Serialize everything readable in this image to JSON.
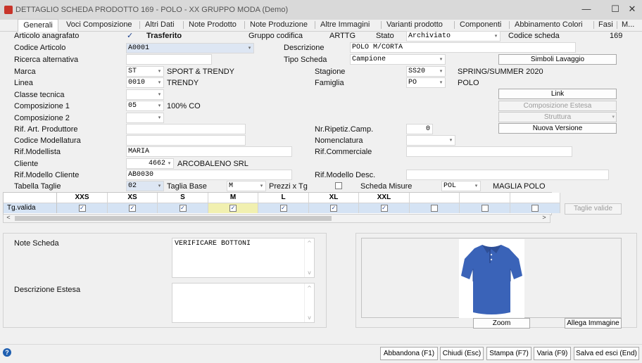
{
  "window": {
    "title": "DETTAGLIO SCHEDA PRODOTTO 169 - POLO - XX  GRUPPO MODA  (Demo)",
    "minimize_glyph": "—",
    "maximize_glyph": "☐",
    "close_glyph": "✕"
  },
  "tabs": [
    {
      "label": "Generali",
      "active": true
    },
    {
      "label": "Voci Composizione"
    },
    {
      "label": "Altri Dati"
    },
    {
      "label": "Note Prodotto"
    },
    {
      "label": "Note Produzione"
    },
    {
      "label": "Altre Immagini"
    },
    {
      "label": "Varianti prodotto"
    },
    {
      "label": "Componenti"
    },
    {
      "label": "Abbinamento Colori"
    },
    {
      "label": "Fasi"
    },
    {
      "label": "M..."
    }
  ],
  "form": {
    "articolo_anagrafato": {
      "label": "Articolo anagrafato",
      "checked": true,
      "check_glyph": "✓"
    },
    "trasferito": "Trasferito",
    "gruppo_codifica": {
      "label": "Gruppo codifica",
      "value": "ARTTG"
    },
    "stato": {
      "label": "Stato",
      "value": "Archiviato"
    },
    "codice_scheda": {
      "label": "Codice scheda",
      "value": "169"
    },
    "codice_articolo": {
      "label": "Codice Articolo",
      "value": "A0001"
    },
    "descrizione": {
      "label": "Descrizione",
      "value": "POLO M/CORTA"
    },
    "ricerca_alternativa": {
      "label": "Ricerca alternativa",
      "value": ""
    },
    "tipo_scheda": {
      "label": "Tipo Scheda",
      "value": "Campione"
    },
    "simboli_lavaggio_button": "Simboli Lavaggio",
    "marca": {
      "label": "Marca",
      "code": "ST",
      "desc": "SPORT & TRENDY"
    },
    "stagione": {
      "label": "Stagione",
      "code": "SS20",
      "desc": "SPRING/SUMMER 2020"
    },
    "linea": {
      "label": "Linea",
      "code": "0010",
      "desc": "TRENDY"
    },
    "famiglia": {
      "label": "Famiglia",
      "code": "PO",
      "desc": "POLO"
    },
    "classe_tecnica": {
      "label": "Classe tecnica",
      "code": ""
    },
    "link_button": "Link",
    "composizione_1": {
      "label": "Composizione 1",
      "code": "05",
      "desc": "100% CO"
    },
    "composizione_estesa_button": "Composizione Estesa",
    "composizione_2": {
      "label": "Composizione 2",
      "code": ""
    },
    "struttura_button": "Struttura",
    "nuova_versione_button": "Nuova Versione",
    "rif_art_produttore": {
      "label": "Rif. Art. Produttore",
      "value": ""
    },
    "nr_ripetiz_camp": {
      "label": "Nr.Ripetiz.Camp.",
      "value": "0"
    },
    "codice_modellatura": {
      "label": "Codice Modellatura",
      "value": ""
    },
    "nomenclatura": {
      "label": "Nomenclatura",
      "value": ""
    },
    "rif_modellista": {
      "label": "Rif.Modellista",
      "value": "MARIA"
    },
    "rif_commerciale": {
      "label": "Rif.Commerciale",
      "value": ""
    },
    "cliente": {
      "label": "Cliente",
      "code": "4662",
      "desc": "ARCOBALENO SRL"
    },
    "rif_modello_cliente": {
      "label": "Rif.Modello Cliente",
      "value": "AB0030"
    },
    "rif_modello_desc": {
      "label": "Rif.Modello Desc.",
      "value": ""
    },
    "tabella_taglie": {
      "label": "Tabella Taglie",
      "value": "02"
    },
    "taglia_base": {
      "label": "Taglia Base",
      "value": "M"
    },
    "prezzi_x_tg": {
      "label": "Prezzi x Tg",
      "checked": false
    },
    "scheda_misure": {
      "label": "Scheda Misure",
      "code": "POL",
      "desc": "MAGLIA POLO"
    }
  },
  "size_grid": {
    "row_label": "Tg.valida",
    "columns": [
      "XXS",
      "XS",
      "S",
      "M",
      "L",
      "XL",
      "XXL",
      "",
      "",
      ""
    ],
    "checked": [
      true,
      true,
      true,
      true,
      true,
      true,
      true,
      false,
      false,
      false
    ],
    "selected_index": 3,
    "taglie_valide_button": "Taglie valide",
    "scroll_left_glyph": "<",
    "scroll_right_glyph": ">"
  },
  "notes": {
    "note_scheda_label": "Note Scheda",
    "note_scheda_value": "VERIFICARE BOTTONI",
    "descrizione_estesa_label": "Descrizione Estesa",
    "descrizione_estesa_value": ""
  },
  "image_panel": {
    "zoom_button": "Zoom",
    "allega_button": "Allega Immagine"
  },
  "footer": {
    "help_glyph": "?",
    "buttons": [
      "Abbandona (F1)",
      "Chiudi (Esc)",
      "Stampa (F7)",
      "Varia (F9)",
      "Salva ed esci (End)"
    ]
  },
  "colors": {
    "grid_row": "#d5e3f4",
    "grid_selected": "#f1f0b0",
    "polo_shirt": "#3a63b8"
  }
}
